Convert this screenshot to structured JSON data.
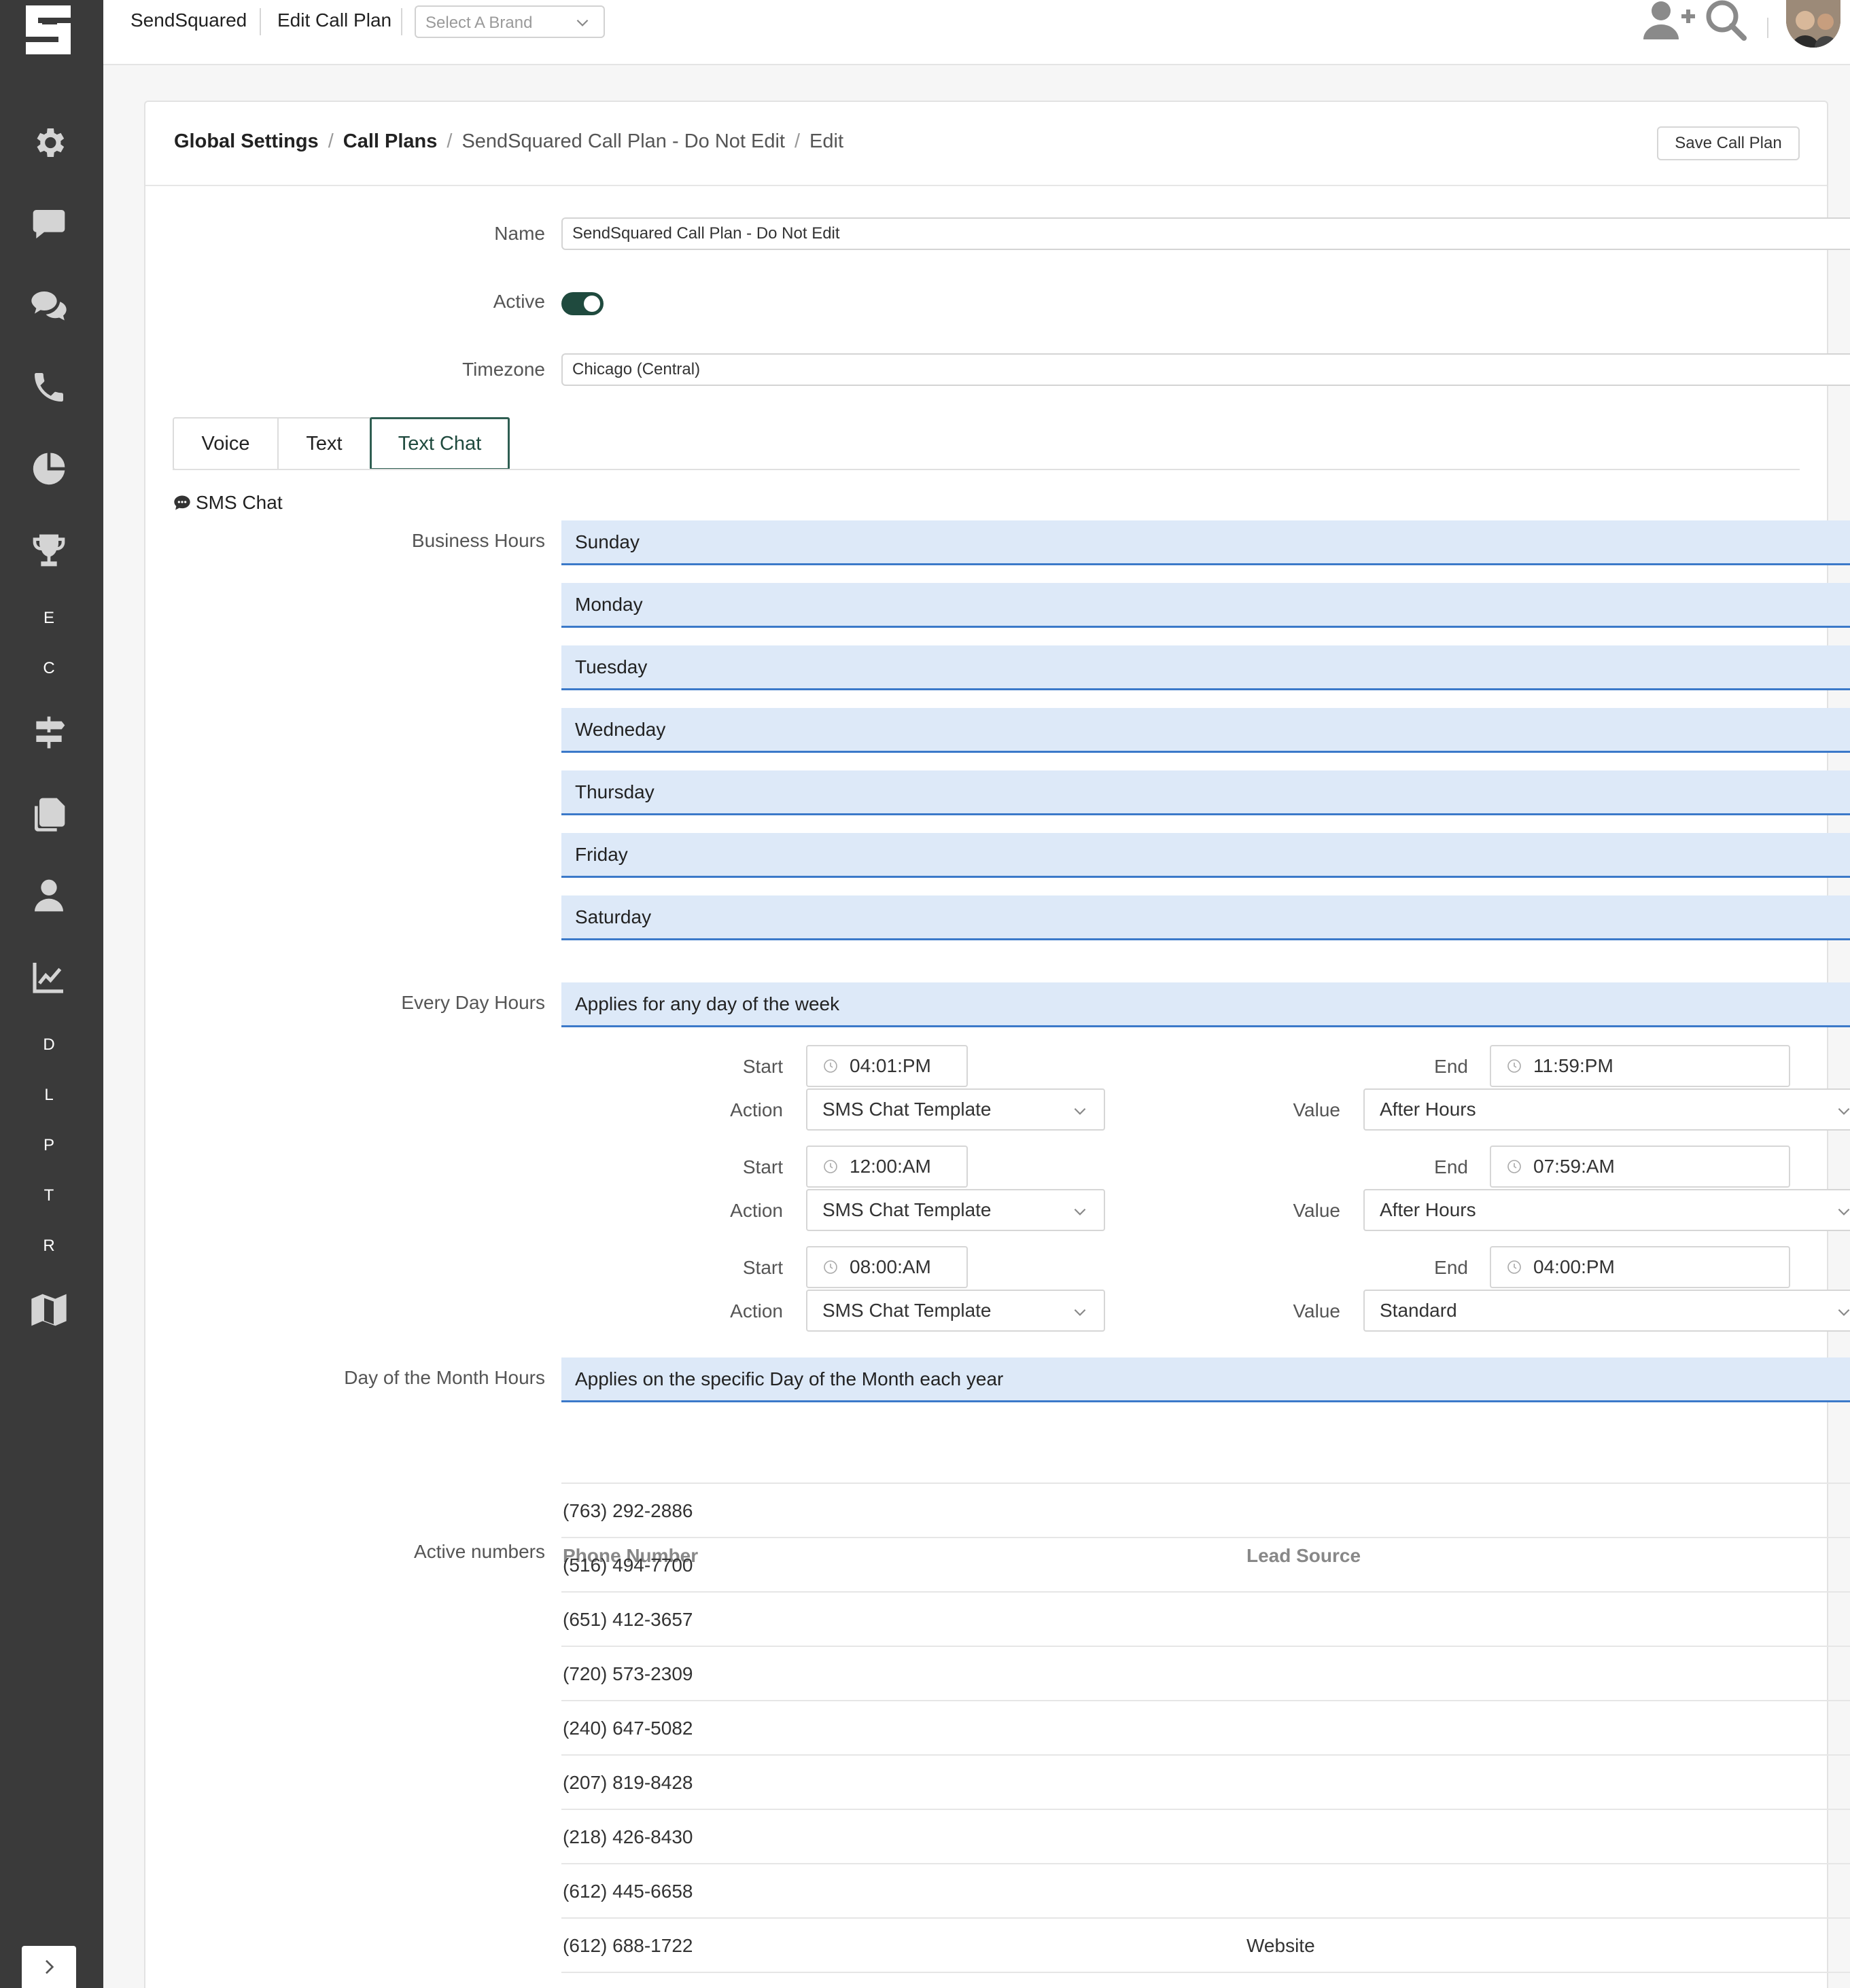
{
  "topbar": {
    "app_name": "SendSquared",
    "page_name": "Edit Call Plan",
    "brand_placeholder": "Select A Brand"
  },
  "sidebar": {
    "letters": [
      "E",
      "C",
      "D",
      "L",
      "P",
      "T",
      "R"
    ],
    "icons": [
      "gear-icon",
      "comment-icon",
      "comments-icon",
      "phone-icon",
      "pie-chart-icon",
      "trophy-icon",
      "signpost-icon",
      "copy-icon",
      "user-icon",
      "line-chart-icon",
      "map-icon"
    ]
  },
  "breadcrumb": {
    "item1": "Global Settings",
    "item2": "Call Plans",
    "item3": "SendSquared Call Plan - Do Not Edit",
    "item4": "Edit",
    "separator": "/"
  },
  "save_button": "Save Call Plan",
  "form": {
    "name_label": "Name",
    "name_value": "SendSquared Call Plan - Do Not Edit",
    "active_label": "Active",
    "active_on": true,
    "timezone_label": "Timezone",
    "timezone_value": "Chicago (Central)"
  },
  "tabs": [
    "Voice",
    "Text",
    "Text Chat"
  ],
  "section_title": "SMS Chat",
  "business_hours_label": "Business Hours",
  "days": [
    "Sunday",
    "Monday",
    "Tuesday",
    "Wedneday",
    "Thursday",
    "Friday",
    "Saturday"
  ],
  "every_day_label": "Every Day Hours",
  "every_day_bar": "Applies for any day of the week",
  "rule_labels": {
    "start": "Start",
    "end": "End",
    "action": "Action",
    "value": "Value"
  },
  "rules": [
    {
      "start": "04:01:PM",
      "end": "11:59:PM",
      "action": "SMS Chat Template",
      "value": "After Hours"
    },
    {
      "start": "12:00:AM",
      "end": "07:59:AM",
      "action": "SMS Chat Template",
      "value": "After Hours"
    },
    {
      "start": "08:00:AM",
      "end": "04:00:PM",
      "action": "SMS Chat Template",
      "value": "Standard"
    }
  ],
  "month_label": "Day of the Month Hours",
  "month_bar": "Applies on the specific Day of the Month each year",
  "active_numbers_label": "Active numbers",
  "table": {
    "headers": [
      "Phone Number",
      "Lead Source"
    ],
    "rows": [
      {
        "phone": "(763) 292-2886",
        "source": ""
      },
      {
        "phone": "(516) 494-7700",
        "source": ""
      },
      {
        "phone": "(651) 412-3657",
        "source": ""
      },
      {
        "phone": "(720) 573-2309",
        "source": ""
      },
      {
        "phone": "(240) 647-5082",
        "source": ""
      },
      {
        "phone": "(207) 819-8428",
        "source": ""
      },
      {
        "phone": "(218) 426-8430",
        "source": ""
      },
      {
        "phone": "(612) 445-6658",
        "source": ""
      },
      {
        "phone": "(612) 688-1722",
        "source": "Website"
      }
    ]
  },
  "colors": {
    "sidebar": "#3a3a3a",
    "accent": "#1f4a3e",
    "bar_bg": "#dde9f8",
    "bar_border": "#3b79c9"
  }
}
